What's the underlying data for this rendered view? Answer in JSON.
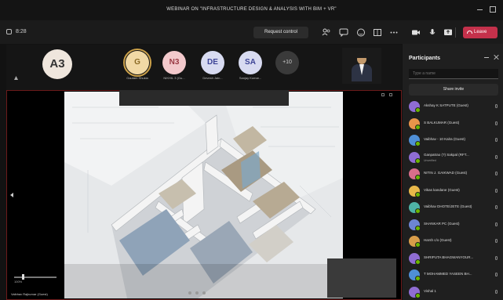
{
  "window": {
    "title": "WEBINAR ON \"INFRASTRUCTURE DESIGN & ANALYSIS WITH BIM + VR\""
  },
  "toolbar": {
    "timer": "8:28",
    "request_control_label": "Request control",
    "leave_label": "Leave",
    "icons": [
      "participants-icon",
      "chat-icon",
      "reactions-icon",
      "rooms-icon",
      "more-icon",
      "camera-icon",
      "mic-icon",
      "share-icon"
    ]
  },
  "strip": {
    "featured": {
      "initials": "A3"
    },
    "participants": [
      {
        "initials": "G",
        "caption": "Gautam Shukla"
      },
      {
        "initials": "N3",
        "caption": "NIKHIL 3 (Gu..."
      },
      {
        "initials": "DE",
        "caption": "Devesh Jain..."
      },
      {
        "initials": "SA",
        "caption": "Sanjay Kumar..."
      }
    ],
    "more": {
      "label": "+10"
    }
  },
  "stage": {
    "zoom_label": "100%",
    "presenter": "Vaibhav Rajkumar (Guest)"
  },
  "panel": {
    "title": "Participants",
    "search_placeholder": "Type a name",
    "share_invite_label": "Share invite",
    "people": [
      {
        "name": "Akshay K SATPUTE (Guest)",
        "color": "#8f6dd3"
      },
      {
        "name": "S BALKUMAR (Guest)",
        "color": "#e8944a"
      },
      {
        "name": "Vaibhav - 10 Kalra (Guest)",
        "color": "#4f8fd6"
      },
      {
        "name": "Ganpatrao (?) Sakpal (RFT...",
        "sub": "Unverified",
        "color": "#8f6dd3"
      },
      {
        "name": "NITIN J. GAIKWAD (Guest)",
        "color": "#d86e8a"
      },
      {
        "name": "Vikas kandane (Guest)",
        "color": "#e8b84a"
      },
      {
        "name": "Vaibhav DHOTE/JETE (Guest)",
        "color": "#4fb3a6"
      },
      {
        "name": "SHANKAR PC (Guest)",
        "color": "#6d85d3"
      },
      {
        "name": "Harsh c/o (Guest)",
        "color": "#d89d4a"
      },
      {
        "name": "SHRIPUTA BHAGWANYOUR...",
        "color": "#8f6dd3"
      },
      {
        "name": "T MOHAMMED YASEEN BH...",
        "color": "#4f8fd6"
      },
      {
        "name": "Vishal 1",
        "color": "#8f6dd3"
      }
    ]
  }
}
